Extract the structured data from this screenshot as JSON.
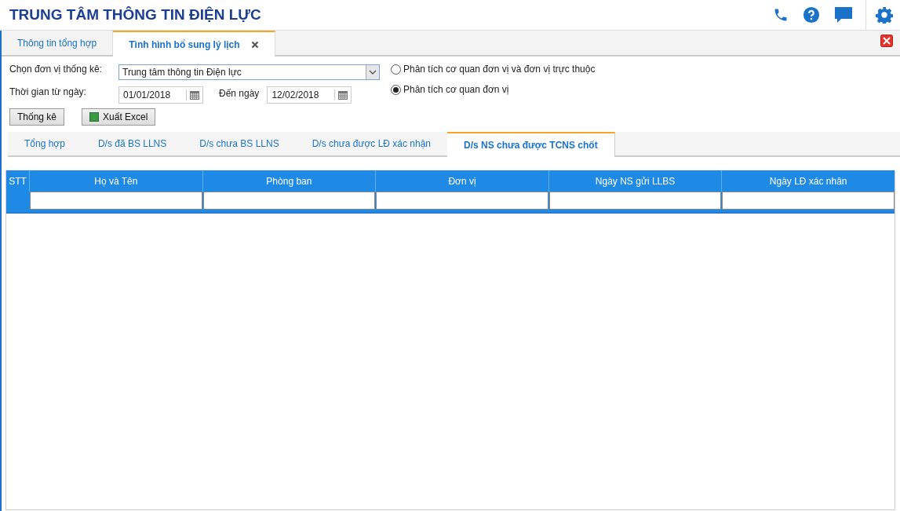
{
  "header": {
    "title": "TRUNG TÂM THÔNG TIN ĐIỆN LỰC"
  },
  "tabs": [
    {
      "label": "Thông tin tổng hợp",
      "selected": false,
      "closable": false
    },
    {
      "label": "Tình hình bổ sung lý lịch",
      "selected": true,
      "closable": true
    }
  ],
  "form": {
    "unit_label": "Chọn đơn vị thống kê:",
    "unit_value": "Trung tâm thông tin Điện lực",
    "from_label": "Thời gian từ ngày:",
    "from_value": "01/01/2018",
    "to_label": "Đến ngày",
    "to_value": "12/02/2018",
    "options": [
      {
        "label": "Phân tích cơ quan đơn vị và đơn vị trực thuộc",
        "selected": false
      },
      {
        "label": "Phân tích cơ quan đơn vị",
        "selected": true
      }
    ],
    "buttons": [
      {
        "label": "Thống kê",
        "kind": "plain"
      },
      {
        "label": "Xuất Excel",
        "kind": "excel"
      }
    ]
  },
  "subtabs": [
    {
      "label": "Tổng hợp",
      "selected": false
    },
    {
      "label": "D/s đã BS LLNS",
      "selected": false
    },
    {
      "label": "D/s chưa BS LLNS",
      "selected": false
    },
    {
      "label": "D/s chưa được LĐ xác nhận",
      "selected": false
    },
    {
      "label": "D/s NS chưa được TCNS chốt",
      "selected": true
    }
  ],
  "table": {
    "columns": [
      "STT",
      "Họ và Tên",
      "Phòng ban",
      "Đơn vị",
      "Ngày NS gửi LLBS",
      "Ngày LĐ xác nhân"
    ]
  }
}
